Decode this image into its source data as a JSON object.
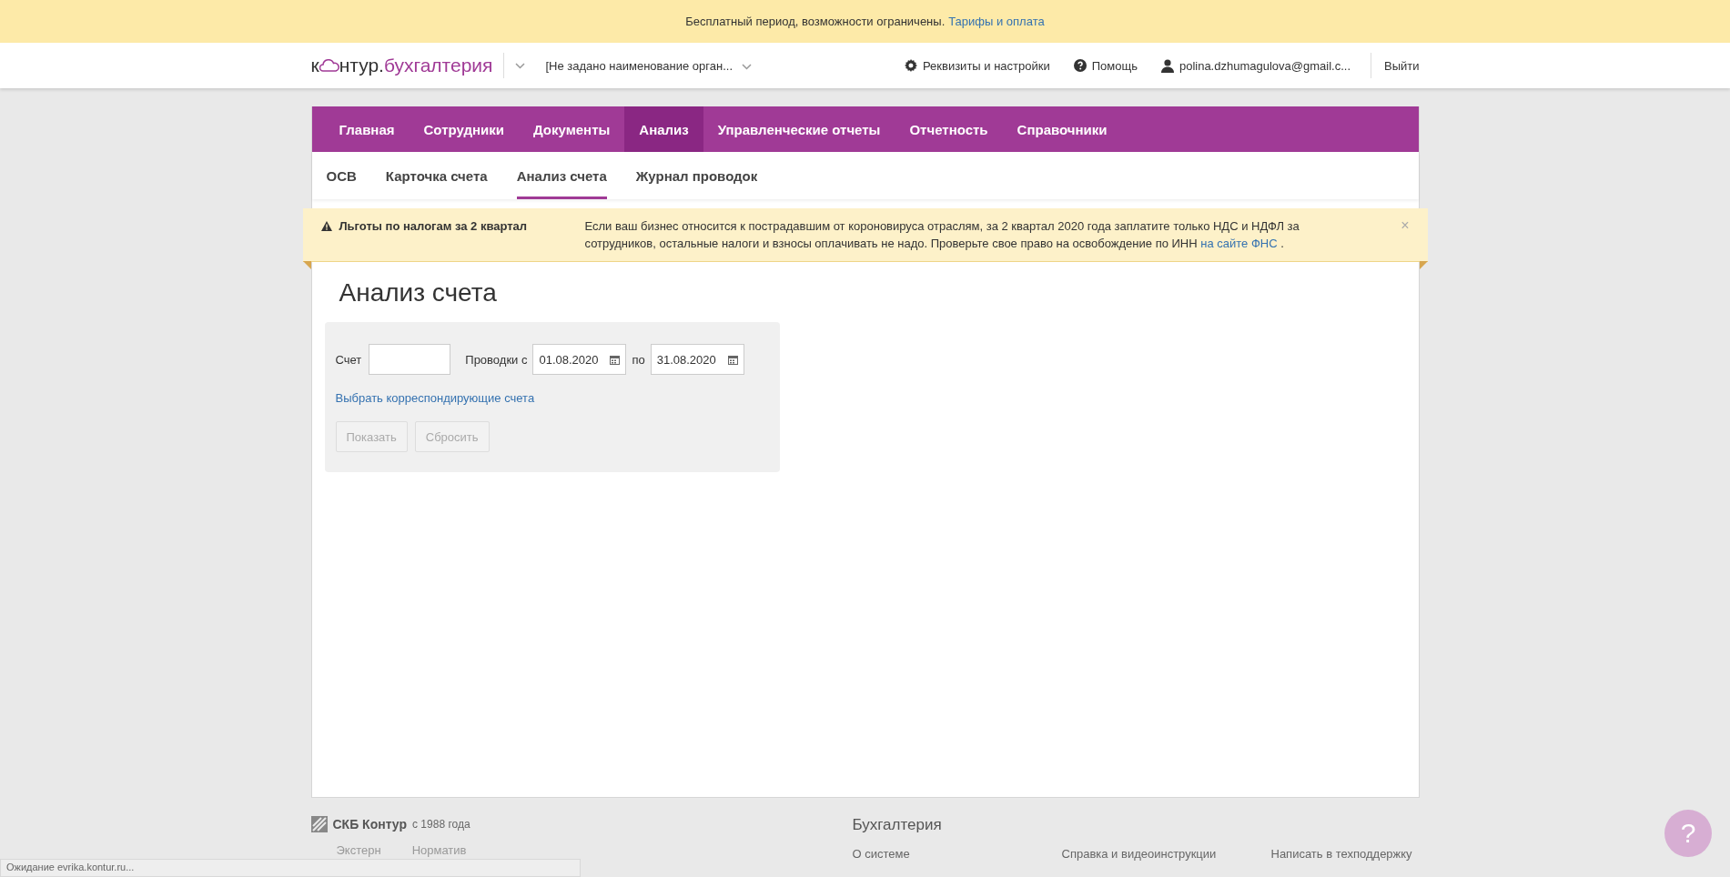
{
  "promo_banner": {
    "text": "Бесплатный период, возможности ограничены.",
    "link": "Тарифы и оплата"
  },
  "header": {
    "logo": {
      "prefix": "к",
      "rest": "нтур.",
      "product": "бухгалтерия"
    },
    "organization": "[Не задано наименование орган...",
    "links": [
      {
        "kind": "gear",
        "label": "Реквизиты и настройки"
      },
      {
        "kind": "help",
        "label": "Помощь"
      },
      {
        "kind": "user",
        "label": "polina.dzhumagulova@gmail.c..."
      }
    ],
    "logout": "Выйти"
  },
  "main_nav": [
    {
      "label": "Главная",
      "selected": false
    },
    {
      "label": "Сотрудники",
      "selected": false
    },
    {
      "label": "Документы",
      "selected": false
    },
    {
      "label": "Анализ",
      "selected": true
    },
    {
      "label": "Управленческие отчеты",
      "selected": false
    },
    {
      "label": "Отчетность",
      "selected": false
    },
    {
      "label": "Справочники",
      "selected": false
    }
  ],
  "sub_nav": [
    {
      "label": "ОСВ",
      "selected": false
    },
    {
      "label": "Карточка счета",
      "selected": false
    },
    {
      "label": "Анализ счета",
      "selected": true
    },
    {
      "label": "Журнал проводок",
      "selected": false
    }
  ],
  "notice": {
    "title": "Льготы по налогам за 2 квартал",
    "text": "Если ваш бизнес относится к пострадавшим от короновируса отраслям, за 2 квартал 2020 года заплатите только НДС и НДФЛ за сотрудников, остальные налоги и взносы оплачивать не надо. Проверьте свое право на освобождение по ИНН",
    "link": "на сайте ФНС",
    "tail": ".",
    "close": "×"
  },
  "page_title": "Анализ счета",
  "form": {
    "account_label": "Счет",
    "period_label": "Проводки с",
    "date_from": "01.08.2020",
    "to_label": "по",
    "date_to": "31.08.2020",
    "link": "Выбрать корреспондирующие счета",
    "buttons": [
      {
        "label": "Показать",
        "disabled": true
      },
      {
        "label": "Сбросить",
        "disabled": true
      }
    ]
  },
  "footer": {
    "brand": "СКБ Контур",
    "since": "с 1988 года",
    "products": [
      "Экстерн",
      "Норматив"
    ],
    "section_title": "Бухгалтерия",
    "links": [
      "О системе",
      "Справка и видеоинструкции",
      "Написать в техподдержку"
    ]
  },
  "status_bar": "Ожидание evrika.kontur.ru...",
  "help_button": "?"
}
